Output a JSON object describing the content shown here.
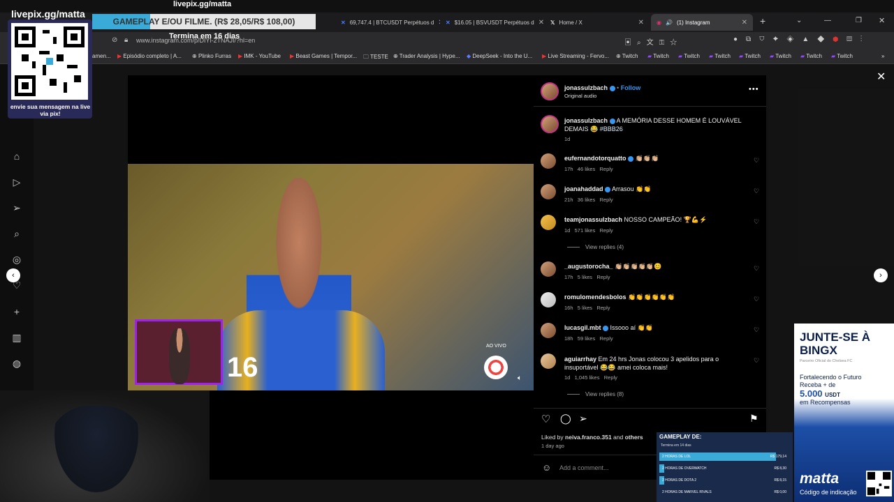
{
  "overlay": {
    "livepix_url": "livepix.gg/matta",
    "livepix_url_top": "livepix.gg/matta",
    "qr_caption": "envie sua mensagem na live via pix!",
    "gameplay_banner": "GAMEPLAY E/OU FILME. (R$ 28,05/R$ 108,00)",
    "termina": "Termina em 16 dias"
  },
  "browser": {
    "tabs": [
      {
        "title": "69,747.4 | BTCUSDT Perpétuos d",
        "close": "✕"
      },
      {
        "title": "$16.05 | BSVUSDT Perpétuos d",
        "close": "✕"
      },
      {
        "title": "Home / X",
        "close": "✕"
      },
      {
        "title": "(1) Instagram",
        "close": "✕"
      }
    ],
    "new_tab": "+",
    "url": "www.instagram.com/p/DIYl-2TNAJI/?hl=en",
    "bookmarks": [
      "amen...",
      "Episódio completo | A...",
      "Plinko Furras",
      "IMK - YouTube",
      "Beast Games | Tempor...",
      "TESTE",
      "Trader Analysis | Hype...",
      "DeepSeek - Into the U...",
      "Live Streaming - Fervo...",
      "Twitch",
      "Twitch",
      "Twitch",
      "Twitch",
      "Twitch",
      "Twitch",
      "Twitch",
      "Twitch"
    ]
  },
  "post": {
    "author": "jonassulzbach",
    "follow": "Follow",
    "audio": "Original audio",
    "caption_user": "jonassulzbach",
    "caption_text": "A MEMÓRIA DESSE HOMEM É LOUVÁVEL DEMAIS 😂",
    "caption_tag": "#BBB26",
    "caption_time": "1d",
    "more": "•••",
    "live_label": "AO VIVO",
    "video_number": "16",
    "comments": [
      {
        "user": "eufernandotorquatto",
        "text": "👏🏼👏🏼👏🏼",
        "time": "17h",
        "likes": "46 likes",
        "reply": "Reply",
        "verified": true
      },
      {
        "user": "joanahaddad",
        "text": "Arrasou 👏👏",
        "time": "21h",
        "likes": "36 likes",
        "reply": "Reply",
        "verified": true
      },
      {
        "user": "teamjonassulzbach",
        "text": "NOSSO CAMPEÃO! 🏆💪⚡",
        "time": "1d",
        "likes": "571 likes",
        "reply": "Reply",
        "verified": false
      },
      {
        "user": "_augustorocha_",
        "text": "👏🏼👏🏼👏🏼👏🏼👏🏼😊",
        "time": "17h",
        "likes": "5 likes",
        "reply": "Reply",
        "verified": false
      },
      {
        "user": "romulomendesbolos",
        "text": "👏👏👏👏👏👏",
        "time": "16h",
        "likes": "5 likes",
        "reply": "Reply",
        "verified": false
      },
      {
        "user": "lucasgil.mbt",
        "text": "Issooo aí 👏👏",
        "time": "18h",
        "likes": "59 likes",
        "reply": "Reply",
        "verified": true
      },
      {
        "user": "aguiarrhay",
        "text": "Em 24 hrs Jonas colocou 3 apelidos para o insuportável 😂😂 amei coloca mais!",
        "time": "1d",
        "likes": "1,045 likes",
        "reply": "Reply",
        "verified": false
      }
    ],
    "view_replies_1": "View replies (4)",
    "view_replies_2": "View replies (8)",
    "liked_by_prefix": "Liked by",
    "liked_by_user": "neiva.franco.351",
    "liked_by_suffix": "and",
    "liked_by_others": "others",
    "post_age": "1 day ago",
    "add_comment": "Add a comment..."
  },
  "ad": {
    "headline": "JUNTE-SE À BINGX",
    "subhead": "Parceiro Oficial do Chelsea FC",
    "line1": "Fortalecendo o Futuro",
    "line2": "Receba + de",
    "amount": "5.000",
    "currency": "USDT",
    "line3": "em Recompensas",
    "brand": "matta",
    "code_label": "Código de indicação"
  },
  "gameplay_panel": {
    "title": "GAMEPLAY DE:",
    "subtitle": "Termina em 14 dias",
    "rows": [
      {
        "label": "2 HORAS DE LOL",
        "price": "R$ 179,14",
        "fill": 0.9
      },
      {
        "label": "2 HORAS DE OVERWATCH",
        "price": "R$ 8,30",
        "fill": 0.04
      },
      {
        "label": "2 HORAS DE DOTA 2",
        "price": "R$ 8,15",
        "fill": 0.04
      },
      {
        "label": "2 HORAS DE MARVEL RIVALS",
        "price": "R$ 0,00",
        "fill": 0.0
      }
    ]
  }
}
